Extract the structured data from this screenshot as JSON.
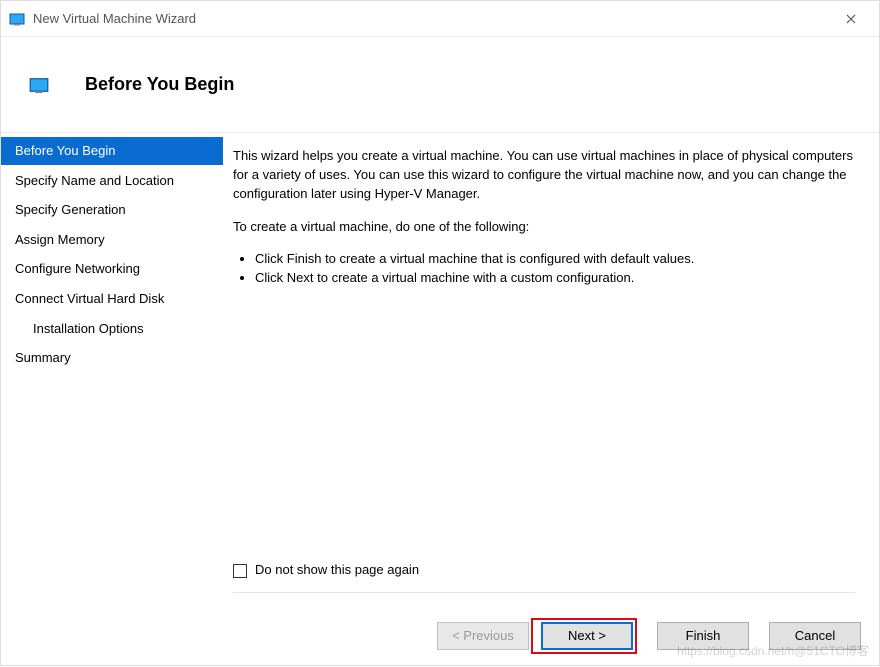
{
  "window": {
    "title": "New Virtual Machine Wizard"
  },
  "header": {
    "title": "Before You Begin"
  },
  "sidebar": {
    "steps": [
      {
        "label": "Before You Begin",
        "active": true
      },
      {
        "label": "Specify Name and Location"
      },
      {
        "label": "Specify Generation"
      },
      {
        "label": "Assign Memory"
      },
      {
        "label": "Configure Networking"
      },
      {
        "label": "Connect Virtual Hard Disk"
      },
      {
        "label": "Installation Options",
        "indent": true
      },
      {
        "label": "Summary"
      }
    ]
  },
  "content": {
    "intro": "This wizard helps you create a virtual machine. You can use virtual machines in place of physical computers for a variety of uses. You can use this wizard to configure the virtual machine now, and you can change the configuration later using Hyper-V Manager.",
    "instruction": "To create a virtual machine, do one of the following:",
    "bullets": [
      "Click Finish to create a virtual machine that is configured with default values.",
      "Click Next to create a virtual machine with a custom configuration."
    ],
    "checkbox_label": "Do not show this page again"
  },
  "footer": {
    "previous": "< Previous",
    "next": "Next >",
    "finish": "Finish",
    "cancel": "Cancel"
  },
  "watermark": "https://blog.csdn.net/h@51CTO博客"
}
